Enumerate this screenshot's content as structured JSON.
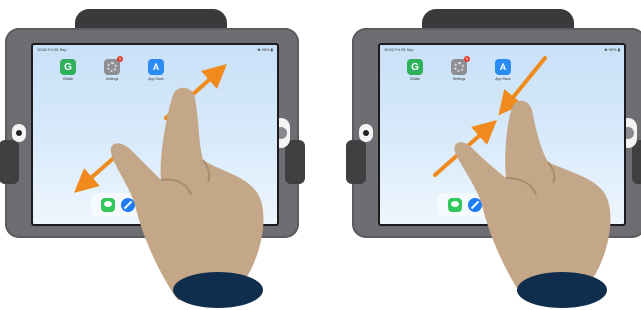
{
  "panels": [
    {
      "gesture": "zoom-in",
      "status_time": "10:52 Fri 25 Sep",
      "status_right": "❀ 99% ▮",
      "apps": [
        {
          "name": "GMath",
          "glyph": "G",
          "icon": "gmath-icon"
        },
        {
          "name": "Settings",
          "glyph": "",
          "icon": "settings-icon",
          "badge": "1"
        },
        {
          "name": "App Store",
          "glyph": "A",
          "icon": "app-store-icon"
        }
      ],
      "dock": [
        "messages-icon",
        "safari-icon"
      ]
    },
    {
      "gesture": "zoom-out",
      "status_time": "10:52 Fri 25 Sep",
      "status_right": "❀ 99% ▮",
      "apps": [
        {
          "name": "GMath",
          "glyph": "G",
          "icon": "gmath-icon"
        },
        {
          "name": "Settings",
          "glyph": "",
          "icon": "settings-icon",
          "badge": "1"
        },
        {
          "name": "App Store",
          "glyph": "A",
          "icon": "app-store-icon"
        }
      ],
      "dock": [
        "messages-icon",
        "safari-icon"
      ]
    }
  ],
  "colors": {
    "arrow": "#f08a1c",
    "hand": "#c4a688",
    "hand_shadow": "#a98b6e",
    "sleeve": "#0f2d4d",
    "case": "#6e6e72",
    "handle": "#3a3a3c"
  }
}
